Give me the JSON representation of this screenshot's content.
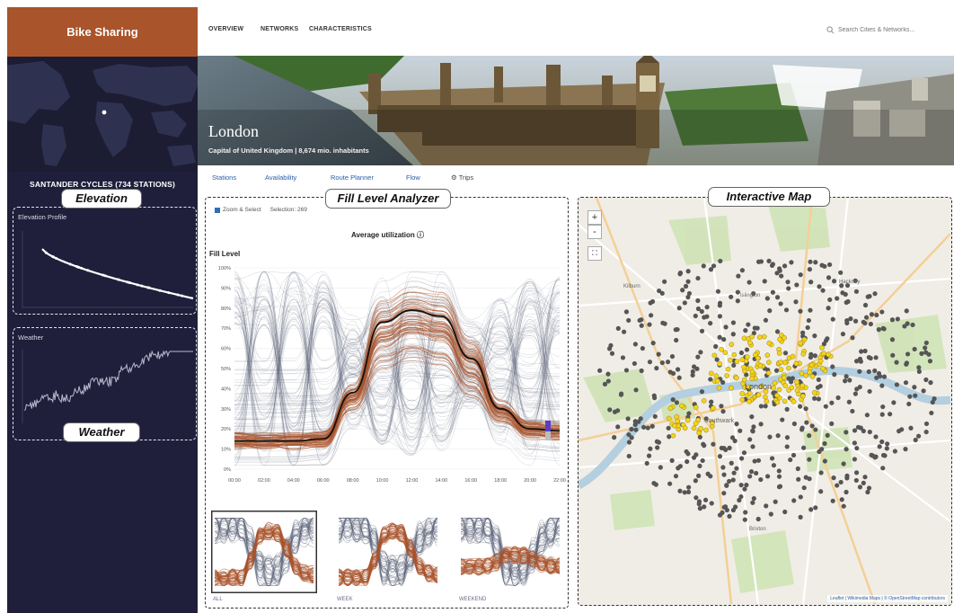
{
  "sidebar": {
    "brand": "Bike Sharing",
    "station_heading": "SANTANDER CYCLES (734 STATIONS)",
    "elevation_panel_title": "Elevation Profile",
    "weather_panel_title": "Weather"
  },
  "callouts": {
    "elevation": "Elevation",
    "weather": "Weather",
    "fill_level": "Fill Level Analyzer",
    "map": "Interactive Map"
  },
  "nav": {
    "items": [
      "OVERVIEW",
      "NETWORKS",
      "CHARACTERISTICS"
    ],
    "search_placeholder": "Search Cities & Networks..."
  },
  "hero": {
    "city": "London",
    "subtitle": "Capital of United Kingdom | 8,674 mio. inhabitants"
  },
  "tabs": [
    "Stations",
    "Availability",
    "Route Planner",
    "Flow",
    "Trips"
  ],
  "analyzer": {
    "zoom_select": "Zoom & Select",
    "selection": "Selection: 269",
    "title": "Average utilization",
    "y_label": "Fill Level",
    "thumb_labels": [
      "ALL",
      "WEEK",
      "WEEKEND"
    ]
  },
  "chart_data": {
    "type": "line",
    "title": "Average utilization",
    "ylabel": "Fill Level",
    "x": [
      "00:00",
      "02:00",
      "04:00",
      "06:00",
      "08:00",
      "10:00",
      "12:00",
      "14:00",
      "16:00",
      "18:00",
      "20:00",
      "22:00"
    ],
    "yticks": [
      "0%",
      "10%",
      "20%",
      "30%",
      "40%",
      "50%",
      "60%",
      "70%",
      "80%",
      "90%",
      "100%"
    ],
    "ylim": [
      0,
      100
    ],
    "series": [
      {
        "values": [
          14,
          14,
          14,
          15,
          38,
          73,
          79,
          76,
          55,
          30,
          20,
          19
        ]
      }
    ]
  },
  "map": {
    "zoom_in": "+",
    "zoom_out": "-",
    "labels": [
      "London",
      "Islington",
      "Hackney",
      "Kilburn",
      "Southwark",
      "Brixton"
    ],
    "attribution": "Leaflet | Wikimedia Maps | © OpenStreetMap contributors"
  },
  "colors": {
    "sidebar_bg": "#1f1f3c",
    "brand_bg": "#a9542b",
    "selected_line": "#a9542b",
    "context_line": "#5a6278",
    "average_line": "#111111",
    "station_selected": "#f4d31a",
    "station_default": "#555555"
  }
}
